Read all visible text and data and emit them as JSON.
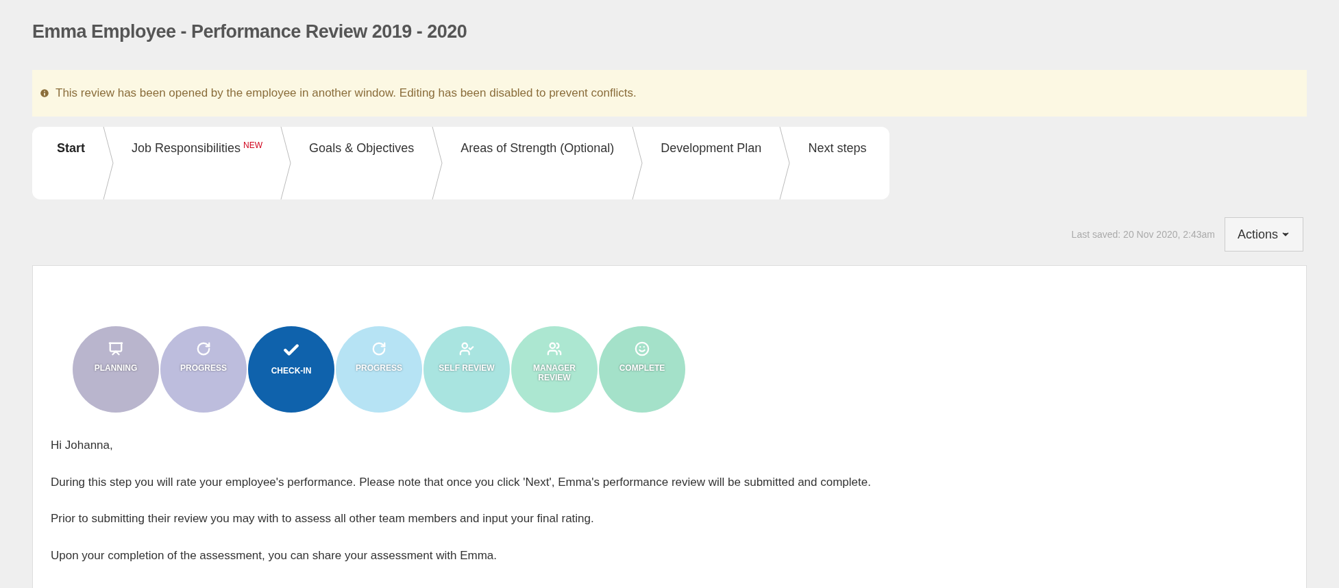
{
  "page_title": "Emma Employee - Performance Review 2019 - 2020",
  "alert": {
    "text": "This review has been opened by the employee in another window. Editing has been disabled to prevent conflicts."
  },
  "tabs": [
    {
      "label": "Start",
      "selected": true
    },
    {
      "label": "Job Responsibilities",
      "badge": "NEW",
      "selected": false
    },
    {
      "label": "Goals & Objectives",
      "selected": false
    },
    {
      "label": "Areas of Strength (Optional)",
      "selected": false
    },
    {
      "label": "Development Plan",
      "selected": false
    },
    {
      "label": "Next steps",
      "selected": false
    }
  ],
  "last_saved": "Last saved: 20 Nov 2020, 2:43am",
  "actions_button": "Actions",
  "stages": [
    {
      "kind": "monitor",
      "label": "PLANNING",
      "color": "#b9b5cd",
      "selected": false
    },
    {
      "kind": "refresh",
      "label": "PROGRESS",
      "color": "#bdbddd",
      "selected": false
    },
    {
      "kind": "check",
      "label": "CHECK-IN",
      "color": "#0f62ac",
      "selected": true
    },
    {
      "kind": "refresh",
      "label": "PROGRESS",
      "color": "#b6e3f4",
      "selected": false
    },
    {
      "kind": "user",
      "label": "SELF REVIEW",
      "color": "#a9e4e0",
      "selected": false
    },
    {
      "kind": "users",
      "label": "MANAGER REVIEW",
      "color": "#ace7d1",
      "selected": false
    },
    {
      "kind": "smile",
      "label": "COMPLETE",
      "color": "#a4e1c9",
      "selected": false
    }
  ],
  "paragraphs": [
    "Hi Johanna,",
    "During this step you will rate your employee's performance. Please note that once you click 'Next', Emma's performance review will be submitted and complete.",
    "Prior to submitting their review you may with to assess all other team members and input your final rating.",
    "Upon your completion of the assessment, you can share your assessment with Emma."
  ]
}
